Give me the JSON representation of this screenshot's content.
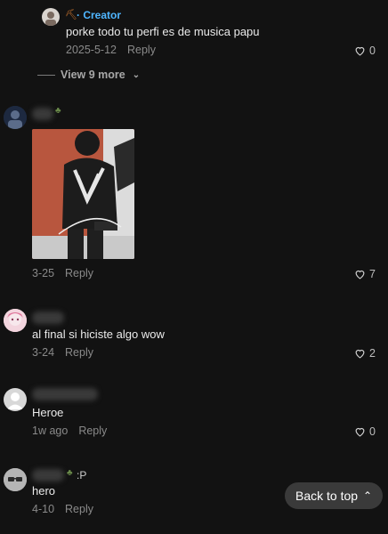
{
  "comments": [
    {
      "badge": "Creator",
      "text": "porke todo tu perfi es de musica papu",
      "date": "2025-5-12",
      "reply": "Reply",
      "likes": "0"
    },
    {
      "date": "3-25",
      "reply": "Reply",
      "likes": "7"
    },
    {
      "text": "al final si hiciste algo wow",
      "date": "3-24",
      "reply": "Reply",
      "likes": "2"
    },
    {
      "text": "Heroe",
      "date": "1w ago",
      "reply": "Reply",
      "likes": "0"
    },
    {
      "name_suffix": ":P",
      "text": "hero",
      "date": "4-10",
      "reply": "Reply"
    }
  ],
  "view_more": "View 9 more",
  "back_to_top": "Back to top",
  "colors": {
    "creator": "#4fb6ff",
    "background": "#121212"
  }
}
